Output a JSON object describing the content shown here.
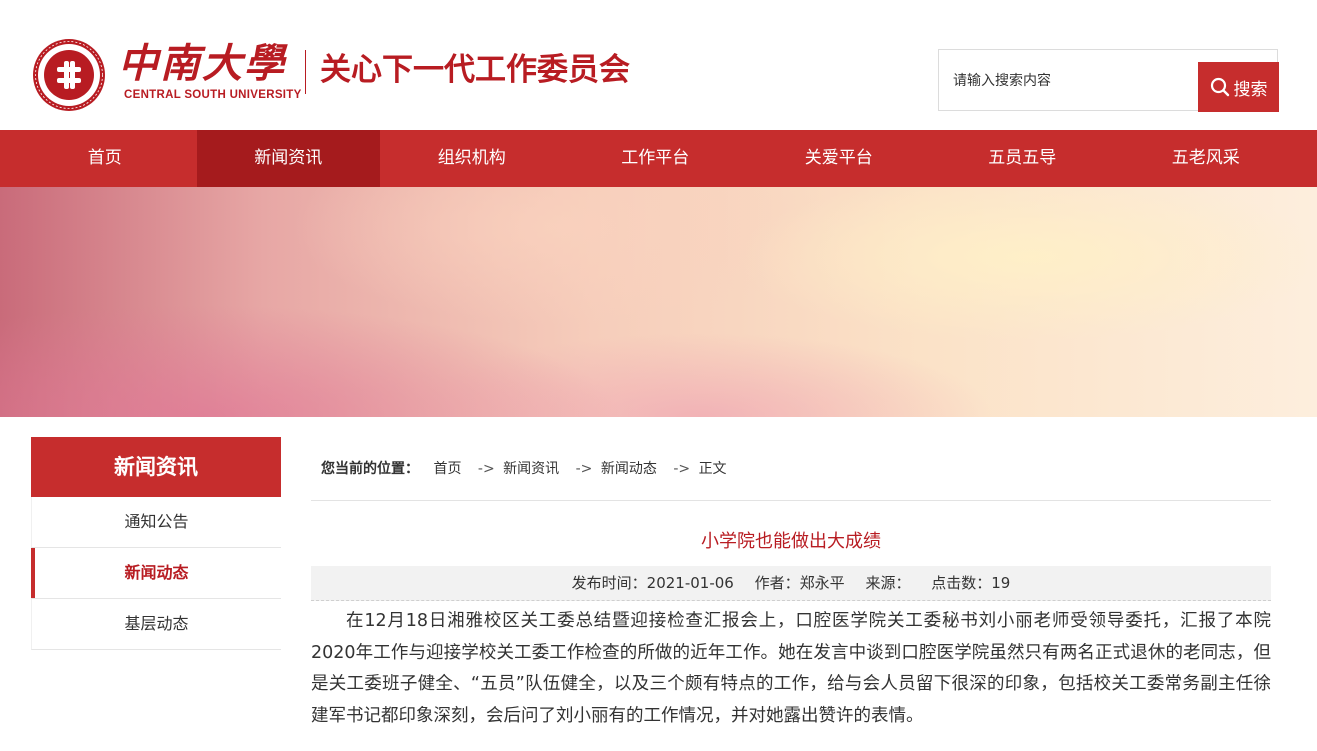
{
  "header": {
    "logo_cn": "中南大學",
    "logo_en": "CENTRAL SOUTH UNIVERSITY",
    "site_title": "关心下一代工作委员会",
    "search_placeholder": "请输入搜索内容",
    "search_button": "搜索"
  },
  "nav": {
    "items": [
      {
        "label": "首页"
      },
      {
        "label": "新闻资讯"
      },
      {
        "label": "组织机构"
      },
      {
        "label": "工作平台"
      },
      {
        "label": "关爱平台"
      },
      {
        "label": "五员五导"
      },
      {
        "label": "五老风采"
      }
    ],
    "active_index": 1
  },
  "sidebar": {
    "title": "新闻资讯",
    "items": [
      {
        "label": "通知公告"
      },
      {
        "label": "新闻动态"
      },
      {
        "label": "基层动态"
      }
    ],
    "active_index": 1
  },
  "breadcrumb": {
    "label": "您当前的位置：",
    "items": [
      "首页",
      "新闻资讯",
      "新闻动态",
      "正文"
    ],
    "separator": "->"
  },
  "article": {
    "title": "小学院也能做出大成绩",
    "meta": {
      "date": "发布时间：2021-01-06",
      "author": "作者：郑永平",
      "source": "来源：",
      "views": "点击数：19"
    },
    "body": "在12月18日湘雅校区关工委总结暨迎接检查汇报会上，口腔医学院关工委秘书刘小丽老师受领导委托，汇报了本院2020年工作与迎接学校关工委工作检查的所做的近年工作。她在发言中谈到口腔医学院虽然只有两名正式退休的老同志，但是关工委班子健全、“五员”队伍健全，以及三个颇有特点的工作，给与会人员留下很深的印象，包括校关工委常务副主任徐建军书记都印象深刻，会后问了刘小丽有的工作情况，并对她露出赞许的表情。"
  },
  "colors": {
    "brand_red": "#c62d2d",
    "active_nav": "#a51b1d",
    "title_red": "#b81c22"
  }
}
